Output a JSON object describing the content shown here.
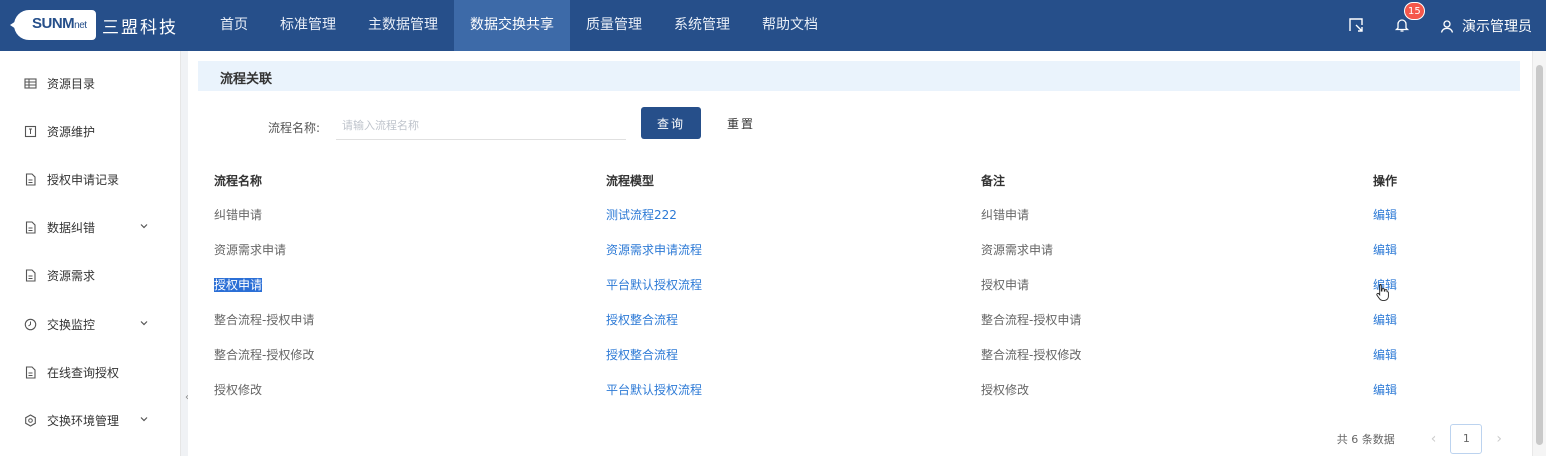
{
  "brand": {
    "logo_text": "SUNM",
    "logo_suffix": "net",
    "name_cn": "三盟科技"
  },
  "nav": {
    "items": [
      {
        "label": "首页"
      },
      {
        "label": "标准管理"
      },
      {
        "label": "主数据管理"
      },
      {
        "label": "数据交换共享",
        "active": true
      },
      {
        "label": "质量管理"
      },
      {
        "label": "系统管理"
      },
      {
        "label": "帮助文档"
      }
    ]
  },
  "topright": {
    "notification_count": "15",
    "username": "演示管理员"
  },
  "sidebar": {
    "items": [
      {
        "label": "资源目录",
        "icon": "grid-icon"
      },
      {
        "label": "资源维护",
        "icon": "doc-icon"
      },
      {
        "label": "授权申请记录",
        "icon": "file-icon"
      },
      {
        "label": "数据纠错",
        "icon": "file-icon",
        "expandable": true
      },
      {
        "label": "资源需求",
        "icon": "file-icon"
      },
      {
        "label": "交换监控",
        "icon": "clock-icon",
        "expandable": true
      },
      {
        "label": "在线查询授权",
        "icon": "file-icon"
      },
      {
        "label": "交换环境管理",
        "icon": "gear-icon",
        "expandable": true
      }
    ],
    "collapse_glyph": "‹"
  },
  "main": {
    "title": "流程关联",
    "search": {
      "label": "流程名称:",
      "placeholder": "请输入流程名称",
      "value": ""
    },
    "buttons": {
      "query": "查询",
      "reset": "重置"
    },
    "table": {
      "headers": [
        "流程名称",
        "流程模型",
        "备注",
        "操作"
      ],
      "rows": [
        {
          "name": "纠错申请",
          "model": "测试流程222",
          "remark": "纠错申请",
          "action": "编辑"
        },
        {
          "name": "资源需求申请",
          "model": "资源需求申请流程",
          "remark": "资源需求申请",
          "action": "编辑"
        },
        {
          "name": "授权申请",
          "model": "平台默认授权流程",
          "remark": "授权申请",
          "action": "编辑",
          "selected": true
        },
        {
          "name": "整合流程-授权申请",
          "model": "授权整合流程",
          "remark": "整合流程-授权申请",
          "action": "编辑"
        },
        {
          "name": "整合流程-授权修改",
          "model": "授权整合流程",
          "remark": "整合流程-授权修改",
          "action": "编辑"
        },
        {
          "name": "授权修改",
          "model": "平台默认授权流程",
          "remark": "授权修改",
          "action": "编辑"
        }
      ]
    },
    "pagination": {
      "total_text": "共 6 条数据",
      "current_page": "1",
      "prev": "‹",
      "next": "›"
    }
  },
  "colors": {
    "nav_bg": "#264f8a",
    "nav_active": "#3d6aa8",
    "link": "#2d7ad6",
    "badge": "#f5574b",
    "header_band": "#eaf3fc"
  }
}
